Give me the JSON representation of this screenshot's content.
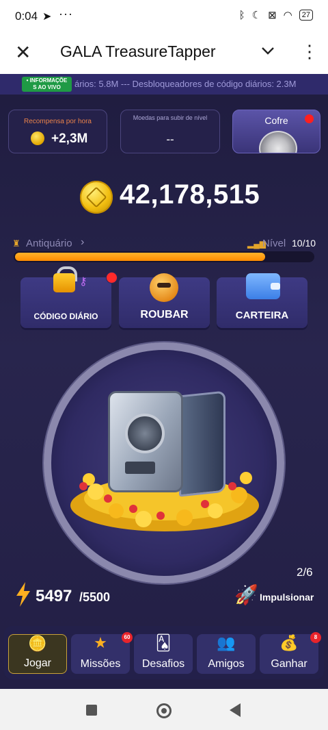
{
  "status_bar": {
    "time": "0:04",
    "dots": "···",
    "battery": "27"
  },
  "header": {
    "title": "GALA TreasureTapper"
  },
  "ticker": {
    "live_badge_line1": "• INFORMAÇÕE",
    "live_badge_line2": "S AO VIVO",
    "text": "ários:  5.8M --- Desbloqueadores de código diários:  2.3M"
  },
  "cards": {
    "reward_label": "Recompensa por hora",
    "reward_value": "+2,3M",
    "level_label": "Moedas para subir de nível",
    "level_value": "--",
    "cofre_label": "Cofre"
  },
  "balance": "42,178,515",
  "rank": {
    "name": "Antiquário",
    "level_label": "Nível",
    "level_value": "10/10",
    "progress": 0.84
  },
  "actions": {
    "code": "CÓDIGO DIÁRIO",
    "rob": "ROUBAR",
    "wallet": "CARTEIRA"
  },
  "boost": {
    "count": "2/6",
    "label": "Impulsionar"
  },
  "energy": {
    "current": "5497",
    "max": "/5500"
  },
  "nav": {
    "play": "Jogar",
    "missions": "Missões",
    "missions_badge": "60",
    "challenges": "Desafios",
    "friends": "Amigos",
    "earn": "Ganhar",
    "earn_badge": "8"
  },
  "colors": {
    "accent_orange": "#ff8b00",
    "badge_red": "#e8242b",
    "background": "#28254d"
  }
}
